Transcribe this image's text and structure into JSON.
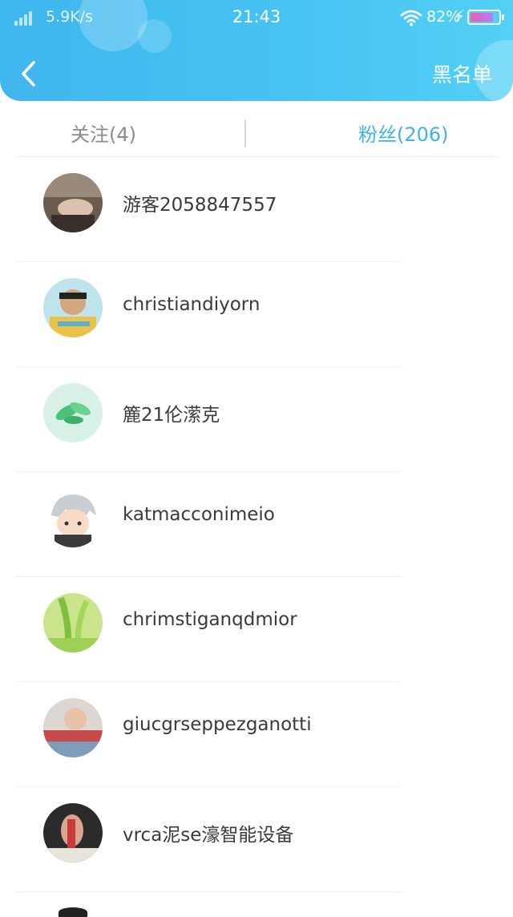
{
  "status_bar": {
    "network_speed": "5.9K/s",
    "time": "21:43",
    "battery_percent": "82%",
    "battery_level": 0.82,
    "wifi_icon": "wifi-icon",
    "signal_icon": "signal-icon"
  },
  "header": {
    "back_icon": "chevron-left-icon",
    "blacklist_label": "黑名单",
    "accent_color": "#46c3f2"
  },
  "tabs": [
    {
      "label": "关注(4)",
      "active": false
    },
    {
      "label": "粉丝(206)",
      "active": true,
      "color": "#3fb3e8"
    }
  ],
  "fans": [
    {
      "name": "游客2058847557"
    },
    {
      "name": "christiandiyorn"
    },
    {
      "name": "簏21伦潆克"
    },
    {
      "name": "katmacconimeio"
    },
    {
      "name": "chrimstiganqdmior"
    },
    {
      "name": "giucgrseppezganotti"
    },
    {
      "name": "vrca泥se濠智能设备"
    }
  ]
}
